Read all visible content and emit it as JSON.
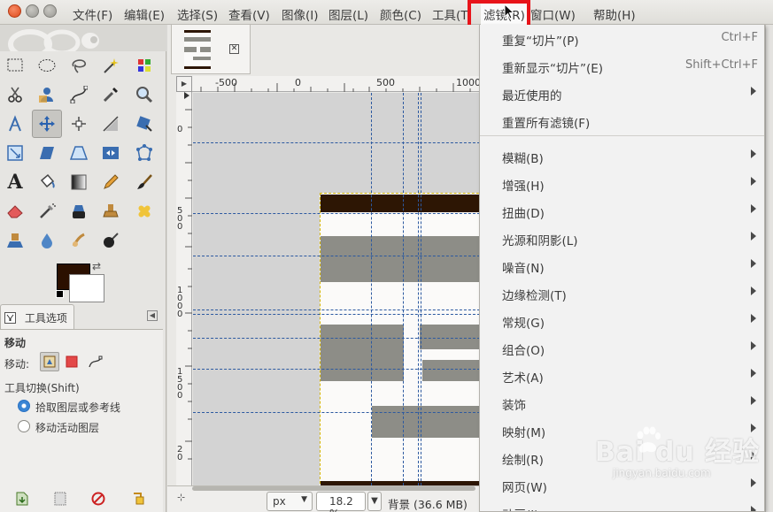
{
  "menubar": {
    "items": [
      "文件(F)",
      "编辑(E)",
      "选择(S)",
      "查看(V)",
      "图像(I)",
      "图层(L)",
      "颜色(C)",
      "工具(T)",
      "滤镜(R)",
      "窗口(W)",
      "帮助(H)"
    ]
  },
  "colors": {
    "foreground": "#2b1000",
    "background": "#ffffff",
    "highlight": "#e8141a",
    "guide": "#2c59a0"
  },
  "tool_options": {
    "tab_label": "工具选项",
    "title": "移动",
    "move_label": "移动:",
    "toggle_label": "工具切换(Shift)",
    "radio_pick": "拾取图层或参考线",
    "radio_active": "移动活动图层"
  },
  "rulers": {
    "h_labels": [
      "-500",
      "0",
      "500",
      "1000"
    ],
    "v_labels": [
      [
        "0"
      ],
      [
        "5",
        "0",
        "0"
      ],
      [
        "1",
        "0",
        "0",
        "0"
      ],
      [
        "1",
        "5",
        "0",
        "0"
      ],
      [
        "2",
        "0"
      ]
    ]
  },
  "status": {
    "unit": "px",
    "zoom": "18.2 %",
    "text": "背景 (36.6 MB)"
  },
  "filters_menu": {
    "items": [
      {
        "label": "重复“切片”(P)",
        "accel": "Ctrl+F"
      },
      {
        "label": "重新显示“切片”(E)",
        "accel": "Shift+Ctrl+F"
      },
      {
        "label": "最近使用的",
        "submenu": true
      },
      {
        "label": "重置所有滤镜(F)"
      },
      {
        "label": "模糊(B)",
        "submenu": true
      },
      {
        "label": "增强(H)",
        "submenu": true
      },
      {
        "label": "扭曲(D)",
        "submenu": true
      },
      {
        "label": "光源和阴影(L)",
        "submenu": true
      },
      {
        "label": "噪音(N)",
        "submenu": true
      },
      {
        "label": "边缘检测(T)",
        "submenu": true
      },
      {
        "label": "常规(G)",
        "submenu": true
      },
      {
        "label": "组合(O)",
        "submenu": true
      },
      {
        "label": "艺术(A)",
        "submenu": true
      },
      {
        "label": "装饰",
        "submenu": true
      },
      {
        "label": "映射(M)",
        "submenu": true
      },
      {
        "label": "绘制(R)",
        "submenu": true
      },
      {
        "label": "网页(W)",
        "submenu": true
      },
      {
        "label": "动画(I)",
        "submenu": true
      }
    ]
  },
  "watermark": {
    "main": "Bai du 经验",
    "sub": "jingyan.baidu.com"
  }
}
